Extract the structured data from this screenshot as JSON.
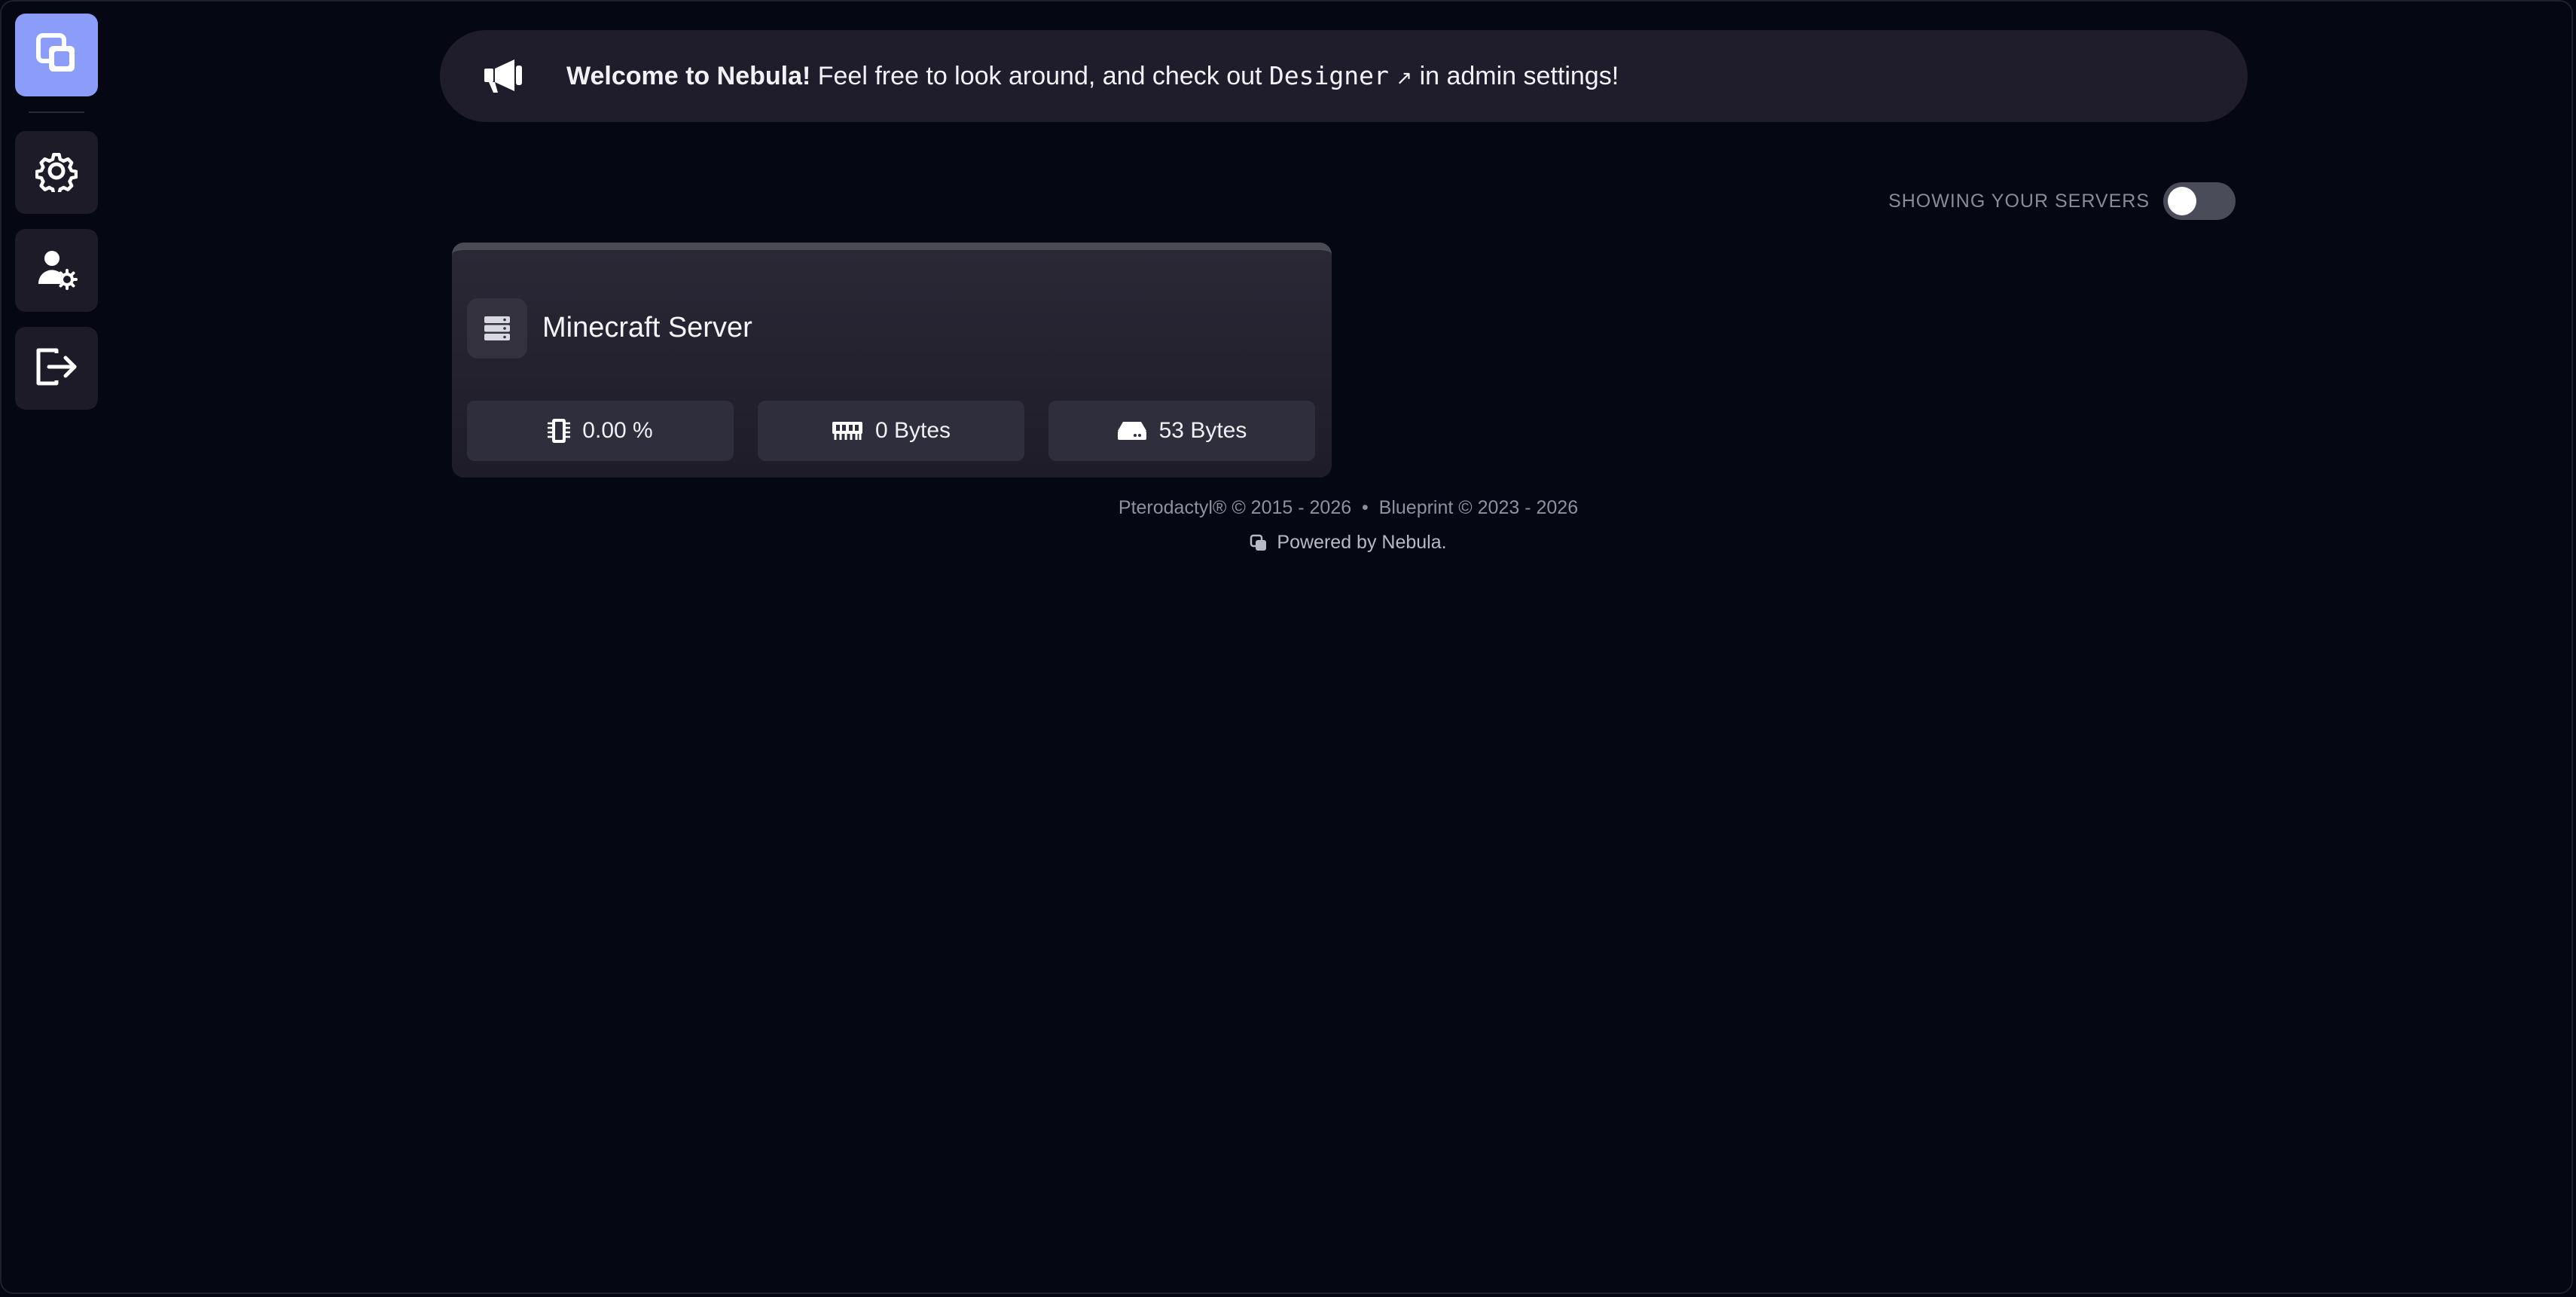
{
  "sidebar": {
    "items": [
      {
        "name": "nebula-logo",
        "icon": "stacked-squares-icon"
      },
      {
        "name": "admin-settings",
        "icon": "gear-icon"
      },
      {
        "name": "account-settings",
        "icon": "user-gear-icon"
      },
      {
        "name": "logout",
        "icon": "logout-icon"
      }
    ],
    "accent": "#8c9cf9"
  },
  "banner": {
    "icon": "megaphone-icon",
    "strong": "Welcome to Nebula!",
    "text1": " Feel free to look around, and check out ",
    "code": "Designer",
    "arrow": "↗",
    "text2": " in admin settings!"
  },
  "filter": {
    "label": "SHOWING YOUR SERVERS",
    "toggle_on": false
  },
  "servers": [
    {
      "name": "Minecraft Server",
      "icon": "server-icon",
      "cpu": "0.00 %",
      "memory": "0 Bytes",
      "disk": "53 Bytes"
    }
  ],
  "footer": {
    "line1": "Pterodactyl® © 2015 - 2026  •  Blueprint © 2023 - 2026",
    "line2": "Powered by Nebula."
  }
}
